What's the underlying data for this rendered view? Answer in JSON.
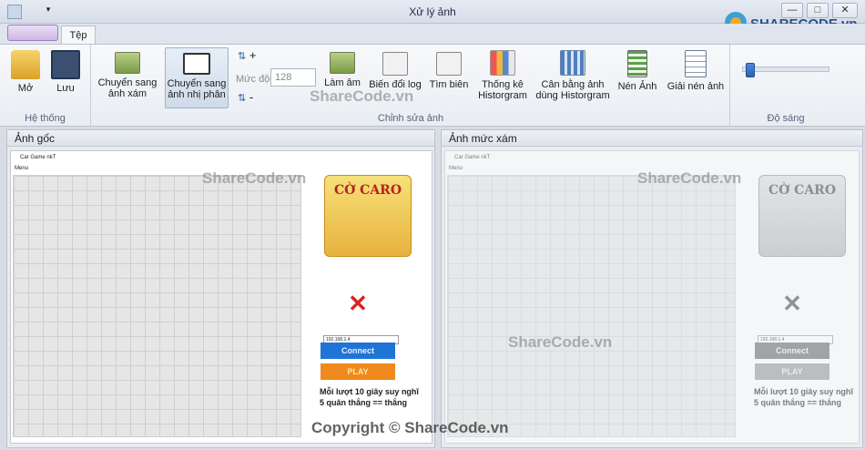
{
  "window": {
    "title": "Xử lý ảnh",
    "minimize": "—",
    "maximize": "□",
    "close": "✕"
  },
  "tabs": {
    "file_tab": "Tệp"
  },
  "ribbon": {
    "system": {
      "caption": "Hệ thống",
      "open": "Mở",
      "save": "Lưu"
    },
    "edit": {
      "caption": "Chỉnh sửa ảnh",
      "to_gray_l1": "Chuyển sang",
      "to_gray_l2": "ảnh xám",
      "to_binary_l1": "Chuyển sang",
      "to_binary_l2": "ảnh nhị phân",
      "level_label": "Mức độ",
      "level_value": "128",
      "plus": "+",
      "minus": "-",
      "negative": "Làm âm",
      "log": "Biến đổi log",
      "edge": "Tìm biên",
      "histogram_l1": "Thống kê",
      "histogram_l2": "Historgram",
      "equalize_l1": "Cân bằng ảnh",
      "equalize_l2": "dùng Historgram",
      "compress": "Nén Ảnh",
      "decompress": "Giải nén ảnh"
    },
    "brightness": {
      "caption": "Độ sáng",
      "value": 0.05
    }
  },
  "panels": {
    "original": "Ảnh gốc",
    "gray": "Ảnh mức xám"
  },
  "preview": {
    "title": "Car Game nkT",
    "menu": "Menu",
    "card_title": "CỜ CARO",
    "ip": "192.168.1.4",
    "connect": "Connect",
    "play": "PLAY",
    "note1": "Mỗi lượt 10 giây suy nghĩ",
    "note2": "5 quân thắng == thắng"
  },
  "watermarks": {
    "text": "ShareCode.vn",
    "copyright": "Copyright © ShareCode.vn",
    "logo": "SHARECODE.vn"
  }
}
